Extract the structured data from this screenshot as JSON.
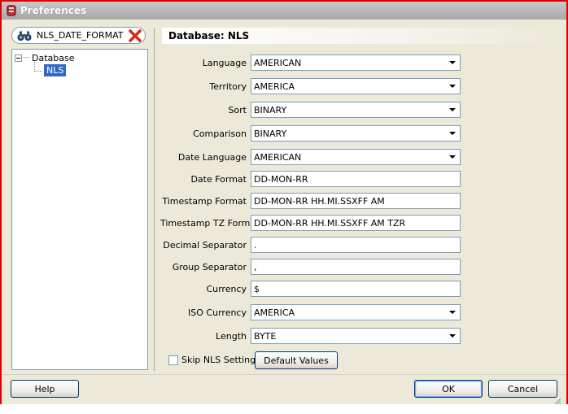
{
  "window": {
    "title": "Preferences",
    "accent": "#e00000"
  },
  "search": {
    "value": "NLS_DATE_FORMAT",
    "icon": "binoculars-icon",
    "clear_icon": "clear-icon"
  },
  "tree": {
    "root": "Database",
    "child": "NLS"
  },
  "panel": {
    "title": "Database: NLS",
    "fields": {
      "language": {
        "label": "Language",
        "value": "AMERICAN"
      },
      "territory": {
        "label": "Territory",
        "value": "AMERICA"
      },
      "sort": {
        "label": "Sort",
        "value": "BINARY"
      },
      "comparison": {
        "label": "Comparison",
        "value": "BINARY"
      },
      "date_language": {
        "label": "Date Language",
        "value": "AMERICAN"
      },
      "date_format": {
        "label": "Date Format",
        "value": "DD-MON-RR"
      },
      "timestamp_format": {
        "label": "Timestamp Format",
        "value": "DD-MON-RR HH.MI.SSXFF AM"
      },
      "timestamp_tz_format": {
        "label": "Timestamp TZ Format",
        "value": "DD-MON-RR HH.MI.SSXFF AM TZR"
      },
      "decimal_separator": {
        "label": "Decimal Separator",
        "value": "."
      },
      "group_separator": {
        "label": "Group Separator",
        "value": ","
      },
      "currency": {
        "label": "Currency",
        "value": "$"
      },
      "iso_currency": {
        "label": "ISO Currency",
        "value": "AMERICA"
      },
      "length": {
        "label": "Length",
        "value": "BYTE"
      }
    },
    "skip_label": "Skip NLS Settings",
    "defaults_button": "Default Values"
  },
  "footer": {
    "help": "Help",
    "ok": "OK",
    "cancel": "Cancel"
  }
}
